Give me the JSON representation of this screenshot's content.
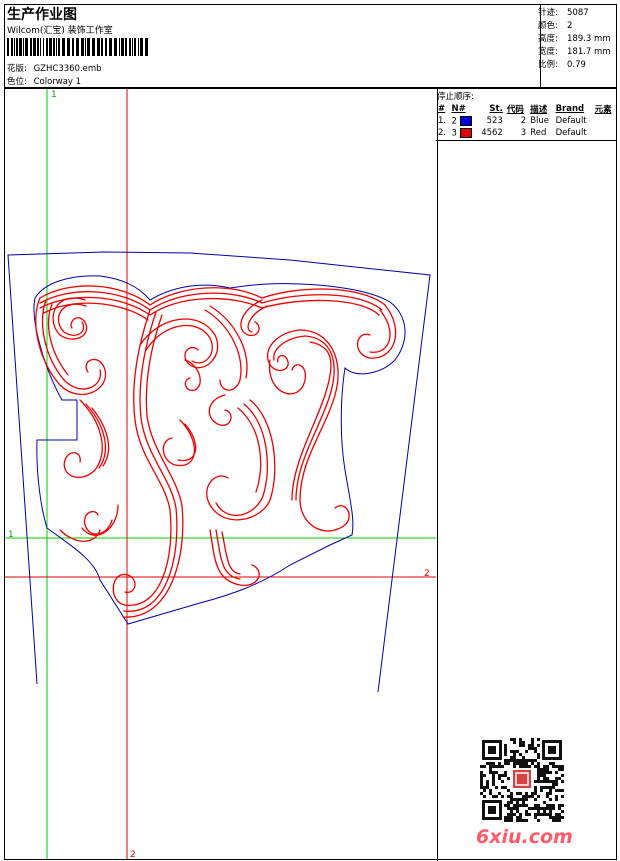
{
  "header": {
    "title": "生产作业图",
    "company": "Wilcom(汇宝) 装饰工作室",
    "design_label": "花版:",
    "design_value": "GZHC3360.emb",
    "colorway_label": "色位:",
    "colorway_value": "Colorway 1"
  },
  "stats": [
    {
      "label": "针迹:",
      "value": "5087"
    },
    {
      "label": "颜色:",
      "value": "2"
    },
    {
      "label": "高度:",
      "value": "189.3 mm"
    },
    {
      "label": "宽度:",
      "value": "181.7 mm"
    },
    {
      "label": "比例:",
      "value": "0.79"
    }
  ],
  "stop_sequence": {
    "title": "停止顺序:",
    "columns": [
      "#",
      "N#",
      "St.",
      "代码",
      "描述",
      "Brand",
      "元素"
    ],
    "rows": [
      {
        "index": "1.",
        "n": "2",
        "color": "#0000dd",
        "stitches": "523",
        "code": "2",
        "desc": "Blue",
        "brand": "Default",
        "element": ""
      },
      {
        "index": "2.",
        "n": "3",
        "color": "#dd0000",
        "stitches": "4562",
        "code": "3",
        "desc": "Red",
        "brand": "Default",
        "element": ""
      }
    ]
  },
  "guides": {
    "green_top": "1",
    "green_left": "1",
    "red_right": "2",
    "red_bottom": "2"
  },
  "watermark": {
    "text": "6xiu.com"
  },
  "colors": {
    "green_guide": "#00cc00",
    "red_guide": "#dd0000",
    "outline": "#0000aa",
    "embroidery": "#ee0000",
    "watermark": "#ff5a6a"
  }
}
